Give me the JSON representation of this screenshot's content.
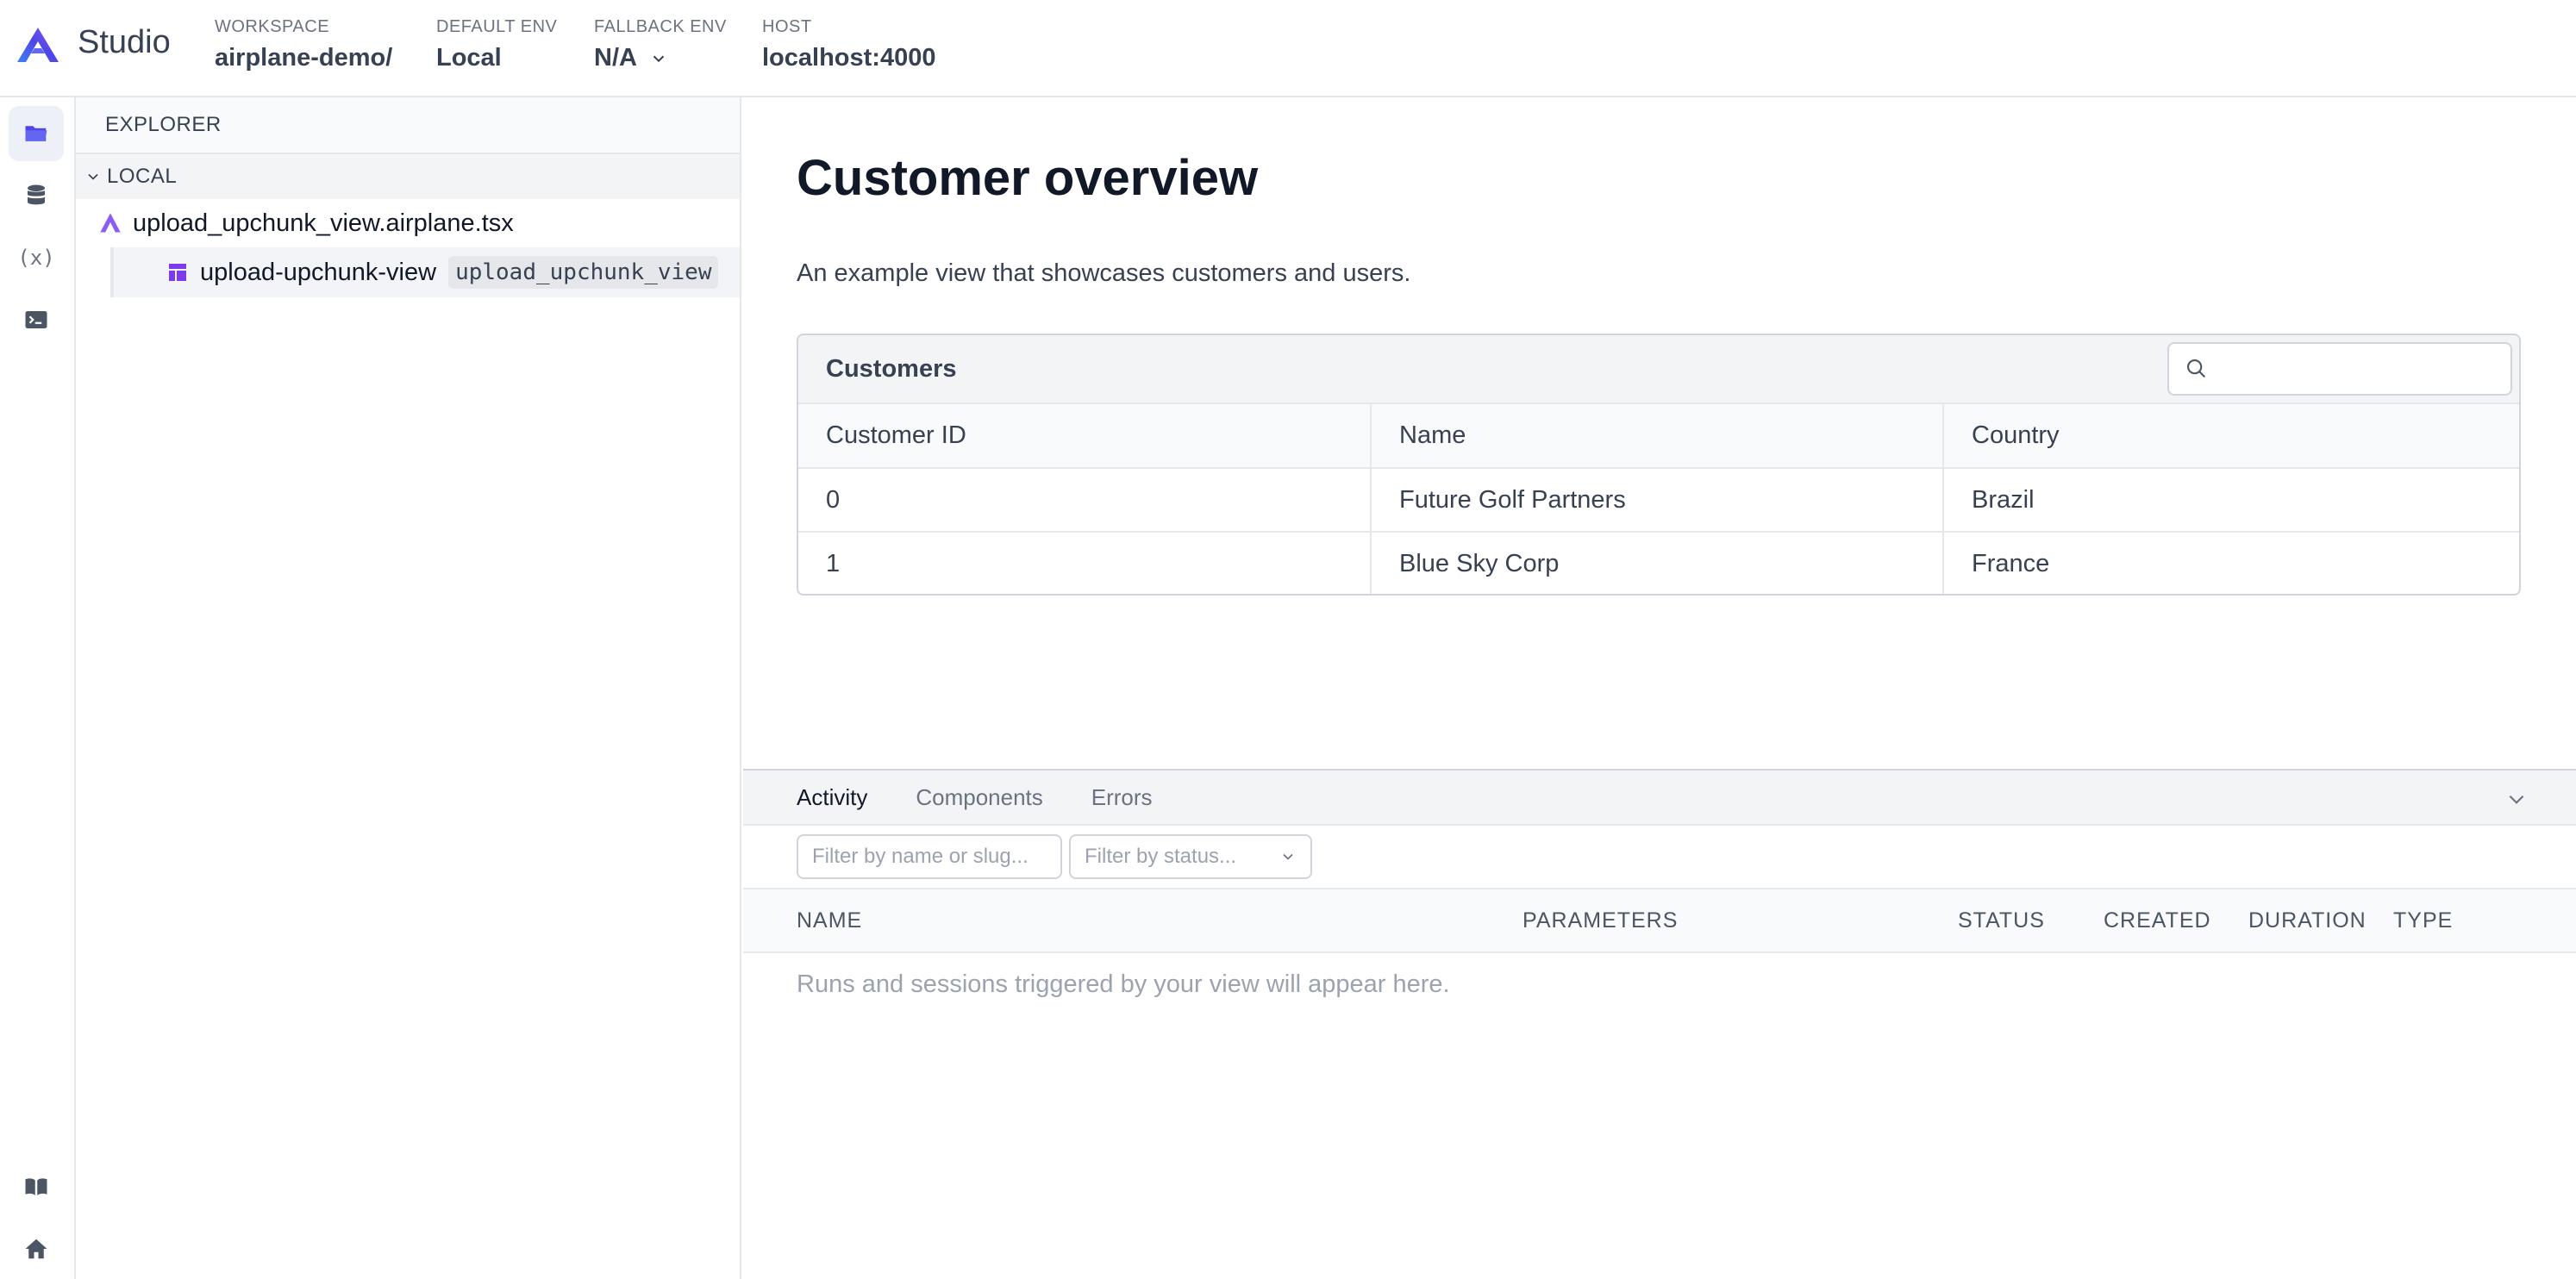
{
  "header": {
    "app_name": "Studio",
    "workspace_label": "WORKSPACE",
    "workspace_value": "airplane-demo/",
    "default_env_label": "DEFAULT ENV",
    "default_env_value": "Local",
    "fallback_env_label": "FALLBACK ENV",
    "fallback_env_value": "N/A",
    "host_label": "HOST",
    "host_value": "localhost:4000"
  },
  "rail": {
    "items": [
      {
        "icon": "folder-icon",
        "active": true
      },
      {
        "icon": "database-icon"
      },
      {
        "icon": "variables-icon",
        "text": "(x)"
      },
      {
        "icon": "terminal-icon"
      }
    ],
    "bottom_items": [
      {
        "icon": "book-icon"
      },
      {
        "icon": "home-icon"
      }
    ]
  },
  "explorer": {
    "title": "EXPLORER",
    "section": "LOCAL",
    "file": "upload_upchunk_view.airplane.tsx",
    "view_name": "upload-upchunk-view",
    "view_slug": "upload_upchunk_view"
  },
  "main": {
    "title": "Customer overview",
    "description": "An example view that showcases customers and users.",
    "table": {
      "title": "Customers",
      "search_placeholder": "",
      "columns": [
        "Customer ID",
        "Name",
        "Country"
      ],
      "rows": [
        [
          "0",
          "Future Golf Partners",
          "Brazil"
        ],
        [
          "1",
          "Blue Sky Corp",
          "France"
        ]
      ]
    }
  },
  "panel": {
    "tabs": [
      "Activity",
      "Components",
      "Errors"
    ],
    "active_tab": "Activity",
    "filter_name_placeholder": "Filter by name or slug...",
    "filter_status_placeholder": "Filter by status...",
    "columns": [
      "NAME",
      "PARAMETERS",
      "STATUS",
      "CREATED",
      "DURATION",
      "TYPE"
    ],
    "empty_message": "Runs and sessions triggered by your view will appear here."
  },
  "colors": {
    "brand": "#4f46e5",
    "accent_purple": "#7c3aed",
    "border": "#e5e7eb"
  }
}
